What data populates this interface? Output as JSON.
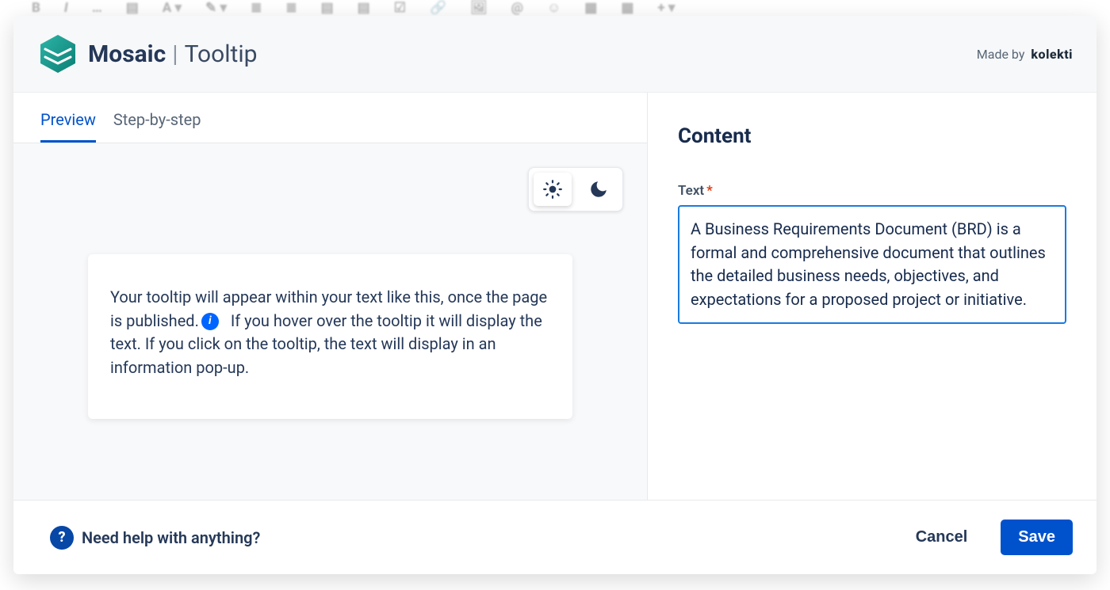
{
  "header": {
    "brand_strong": "Mosaic",
    "brand_pipe": "|",
    "brand_sub": "Tooltip",
    "made_by_prefix": "Made by",
    "made_by_brand": "kolekti"
  },
  "tabs": {
    "preview": "Preview",
    "step_by_step": "Step-by-step",
    "active": "preview"
  },
  "preview": {
    "text_before": "Your tooltip will appear within your text like this, once the page is published.",
    "text_after": "  If you hover over the tooltip it will display the text. If you click on the tooltip, the text will display in an information pop-up."
  },
  "content_panel": {
    "heading": "Content",
    "text_label": "Text",
    "required_mark": "*",
    "text_value": "A Business Requirements Document (BRD) is a formal and comprehensive document that outlines the detailed business needs, objectives, and expectations for a proposed project or initiative."
  },
  "footer": {
    "help_text": "Need help with anything?",
    "cancel": "Cancel",
    "save": "Save"
  }
}
